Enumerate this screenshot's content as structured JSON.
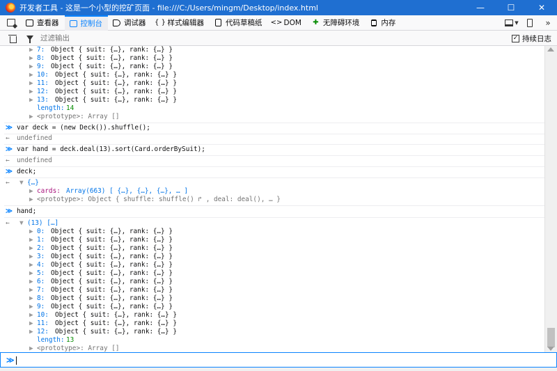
{
  "window": {
    "title": "开发者工具 - 这是一个小型的挖矿页面 - file:///C:/Users/mingm/Desktop/index.html",
    "minimize": "—",
    "maximize": "☐",
    "close": "✕"
  },
  "toolbar": {
    "tabs": [
      {
        "label": "查看器",
        "icon": "inspector-icon"
      },
      {
        "label": "控制台",
        "icon": "console-icon",
        "selected": true
      },
      {
        "label": "调试器",
        "icon": "debugger-icon"
      },
      {
        "label": "样式编辑器",
        "icon": "style-editor-icon"
      },
      {
        "label": "代码草稿纸",
        "icon": "scratchpad-icon"
      },
      {
        "label": "DOM",
        "icon": "dom-icon"
      },
      {
        "label": "无障碍环境",
        "icon": "accessibility-icon"
      },
      {
        "label": "内存",
        "icon": "memory-icon"
      }
    ],
    "inspector": "查看器",
    "console": "控制台",
    "debugger": "调试器",
    "style_editor": "样式编辑器",
    "scratchpad": "代码草稿纸",
    "dom": "DOM",
    "accessibility": "无障碍环境",
    "memory": "内存",
    "more": "»"
  },
  "filterbar": {
    "placeholder": "过滤输出",
    "persist_label": "持续日志",
    "persist_checked": "✓"
  },
  "console": {
    "top_items": [
      {
        "idx": "7",
        "text": "Object { suit: {…}, rank: {…} }"
      },
      {
        "idx": "8",
        "text": "Object { suit: {…}, rank: {…} }"
      },
      {
        "idx": "9",
        "text": "Object { suit: {…}, rank: {…} }"
      },
      {
        "idx": "10",
        "text": "Object { suit: {…}, rank: {…} }"
      },
      {
        "idx": "11",
        "text": "Object { suit: {…}, rank: {…} }"
      },
      {
        "idx": "12",
        "text": "Object { suit: {…}, rank: {…} }"
      },
      {
        "idx": "13",
        "text": "Object { suit: {…}, rank: {…} }"
      }
    ],
    "top_length_key": "length:",
    "top_length_val": "14",
    "top_proto": "<prototype>: Array []",
    "cmd1": "var deck = (new Deck()).shuffle();",
    "res1": "undefined",
    "cmd2": "var hand = deck.deal(13).sort(Card.orderBySuit);",
    "res2": "undefined",
    "cmd3": "deck;",
    "res3_head": "{…}",
    "res3_cards_key": "cards:",
    "res3_cards_val": "Array(663) [ {…}, {…}, {…}, … ]",
    "res3_proto": "<prototype>: Object { shuffle: shuffle() ↱ , deal: deal(), … }",
    "cmd4": "hand;",
    "res4_head": "(13) […]",
    "hand_items": [
      {
        "idx": "0",
        "text": "Object { suit: {…}, rank: {…} }"
      },
      {
        "idx": "1",
        "text": "Object { suit: {…}, rank: {…} }"
      },
      {
        "idx": "2",
        "text": "Object { suit: {…}, rank: {…} }"
      },
      {
        "idx": "3",
        "text": "Object { suit: {…}, rank: {…} }"
      },
      {
        "idx": "4",
        "text": "Object { suit: {…}, rank: {…} }"
      },
      {
        "idx": "5",
        "text": "Object { suit: {…}, rank: {…} }"
      },
      {
        "idx": "6",
        "text": "Object { suit: {…}, rank: {…} }"
      },
      {
        "idx": "7",
        "text": "Object { suit: {…}, rank: {…} }"
      },
      {
        "idx": "8",
        "text": "Object { suit: {…}, rank: {…} }"
      },
      {
        "idx": "9",
        "text": "Object { suit: {…}, rank: {…} }"
      },
      {
        "idx": "10",
        "text": "Object { suit: {…}, rank: {…} }"
      },
      {
        "idx": "11",
        "text": "Object { suit: {…}, rank: {…} }"
      },
      {
        "idx": "12",
        "text": "Object { suit: {…}, rank: {…} }"
      }
    ],
    "hand_length_key": "length:",
    "hand_length_val": "13",
    "hand_proto": "<prototype>: Array []",
    "input_prompt": "≫",
    "prompt_in": "≫",
    "prompt_out": "←",
    "expand": "▶",
    "collapse": "▼"
  },
  "colors": {
    "accent": "#0a84ff",
    "titlebar": "#1f6fd1",
    "object_key": "#0074e8",
    "number": "#058b00"
  }
}
